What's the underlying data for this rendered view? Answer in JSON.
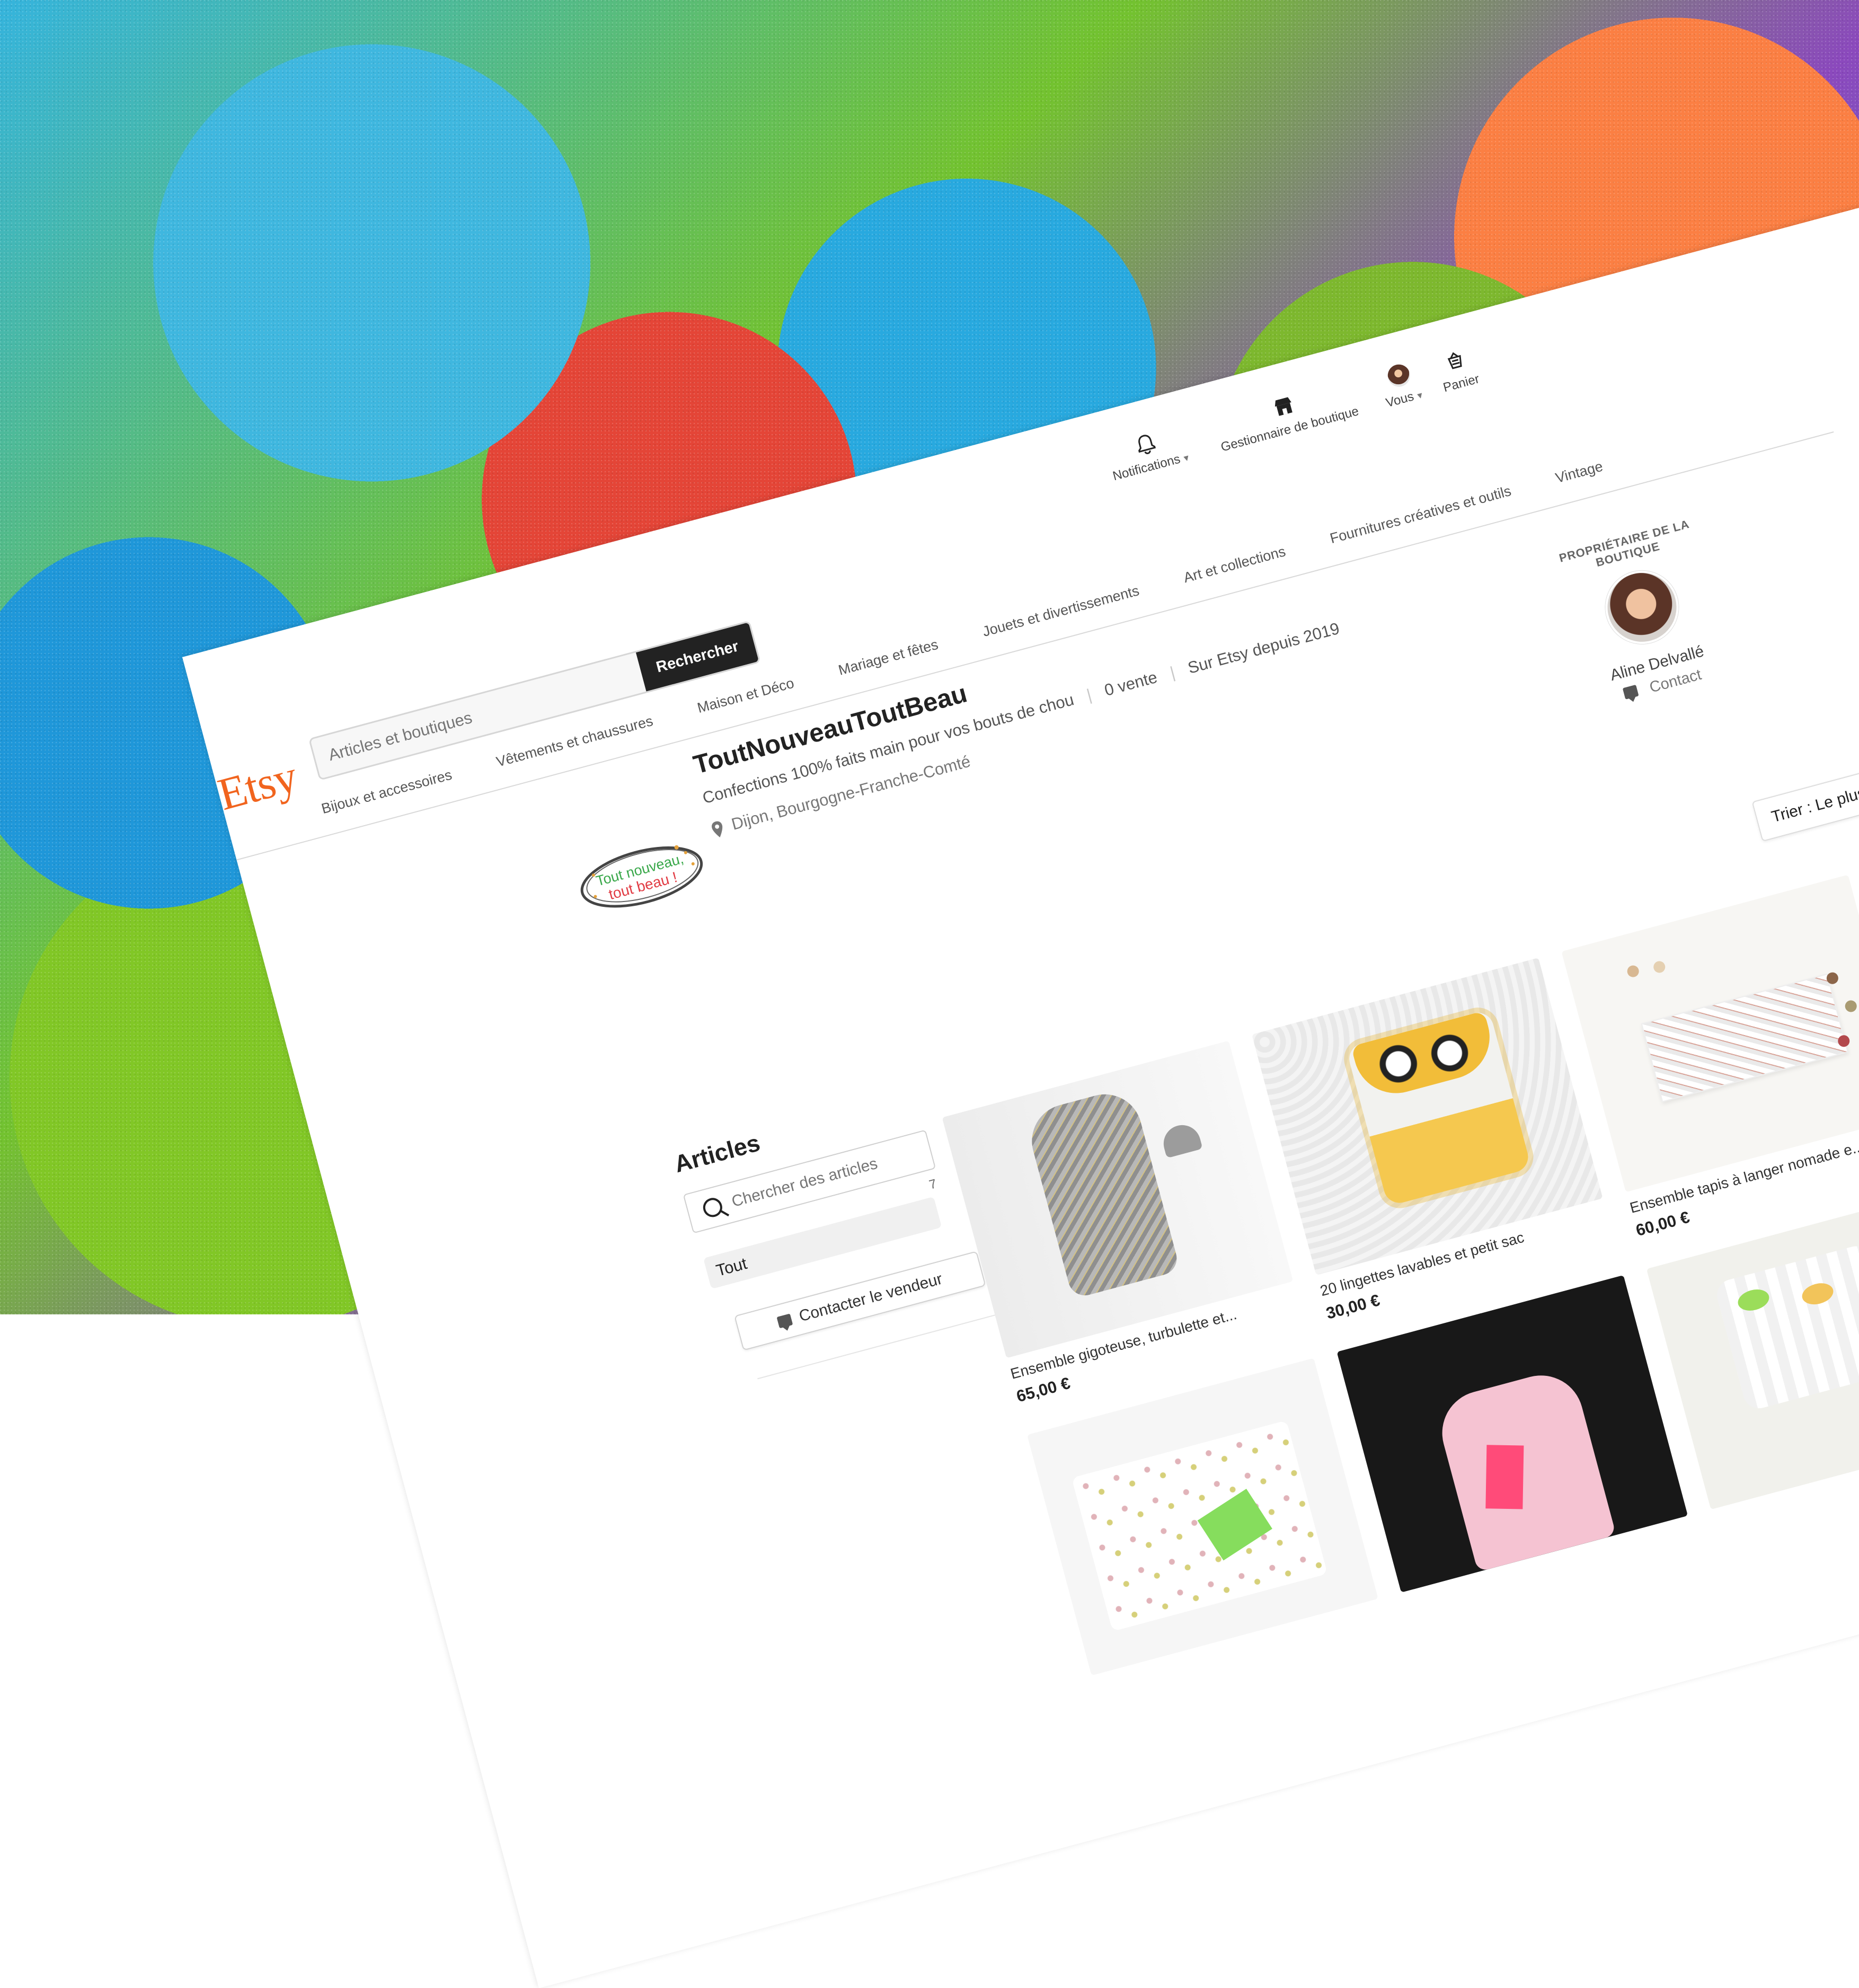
{
  "header": {
    "logo": "Etsy",
    "search_placeholder": "Articles et boutiques",
    "search_button": "Rechercher",
    "top_nav": [
      {
        "label": "Notifications",
        "icon": "bell-icon"
      },
      {
        "label": "Gestionnaire de boutique",
        "icon": "shop-icon"
      },
      {
        "label": "Vous",
        "icon": "avatar"
      },
      {
        "label": "Panier",
        "icon": "basket-icon"
      }
    ],
    "categories": [
      "Bijoux et accessoires",
      "Vêtements et chaussures",
      "Maison et Déco",
      "Mariage et fêtes",
      "Jouets et divertissements",
      "Art et collections",
      "Fournitures créatives et outils",
      "Vintage"
    ]
  },
  "shop": {
    "logo_text_top": "Tout nouveau,",
    "logo_text_bottom": "tout beau !",
    "name": "ToutNouveauToutBeau",
    "tagline": "Confections 100% faits main pour vos bouts de chou",
    "sales": "0 vente",
    "since": "Sur Etsy depuis 2019",
    "location": "Dijon, Bourgogne-Franche-Comté",
    "owner_label": "PROPRIÉTAIRE DE LA BOUTIQUE",
    "owner_name": "Aline Delvallé",
    "owner_contact": "Contact"
  },
  "sidebar": {
    "title": "Articles",
    "search_placeholder": "Chercher des articles",
    "count": "7",
    "selected": "Tout",
    "contact_button": "Contacter le vendeur"
  },
  "sort": {
    "label": "Trier : Le plus récent"
  },
  "listings": [
    {
      "title": "Ensemble gigoteuse, turbulette et...",
      "price": "65,00 €"
    },
    {
      "title": "20 lingettes lavables et petit sac",
      "price": "30,00 €"
    },
    {
      "title": "Ensemble tapis à langer nomade e...",
      "price": "60,00 €"
    },
    {
      "title": "",
      "price": ""
    },
    {
      "title": "",
      "price": ""
    },
    {
      "title": "",
      "price": ""
    }
  ],
  "colors": {
    "etsy_orange": "#f1641e",
    "dark_button": "#222222",
    "accent_green": "#2ea84c",
    "accent_red": "#d93c45"
  }
}
